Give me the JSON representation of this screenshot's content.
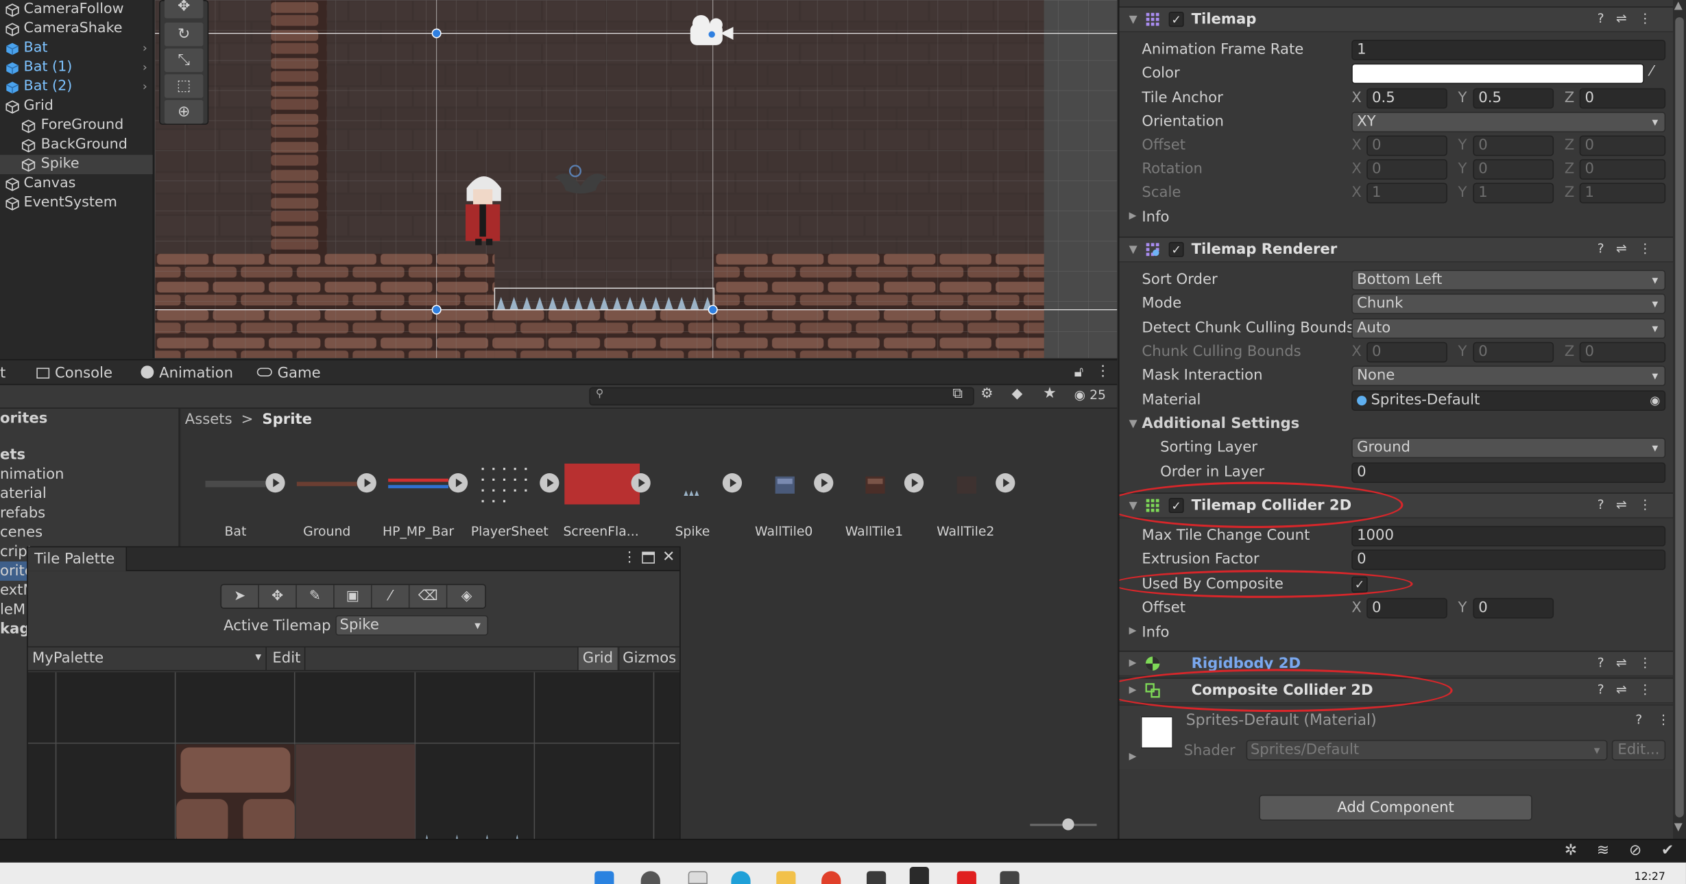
{
  "hierarchy": {
    "items": [
      {
        "label": "CameraFollow"
      },
      {
        "label": "CameraShake"
      },
      {
        "label": "Bat"
      },
      {
        "label": "Bat (1)"
      },
      {
        "label": "Bat (2)"
      },
      {
        "label": "Grid"
      },
      {
        "label": "ForeGround"
      },
      {
        "label": "BackGround"
      },
      {
        "label": "Spike"
      },
      {
        "label": "Canvas"
      },
      {
        "label": "EventSystem"
      }
    ]
  },
  "tabs": {
    "first_fragment": "t",
    "console": "Console",
    "animation": "Animation",
    "game": "Game"
  },
  "project": {
    "hidden_count": "25",
    "left_items": [
      "orites",
      "ets",
      "nimation",
      "aterial",
      "refabs",
      "cenes",
      "cript",
      "orite",
      "extM",
      "leM",
      "kag"
    ],
    "breadcrumb_root": "Assets",
    "breadcrumb_sep": ">",
    "breadcrumb_current": "Sprite",
    "assets": [
      {
        "label": "Bat"
      },
      {
        "label": "Ground"
      },
      {
        "label": "HP_MP_Bar"
      },
      {
        "label": "PlayerSheet"
      },
      {
        "label": "ScreenFla..."
      },
      {
        "label": "Spike"
      },
      {
        "label": "WallTile0"
      },
      {
        "label": "WallTile1"
      },
      {
        "label": "WallTile2"
      }
    ]
  },
  "tile_palette": {
    "title": "Tile Palette",
    "active_tilemap_label": "Active Tilemap",
    "active_tilemap_value": "Spike",
    "palette_name": "MyPalette",
    "edit": "Edit",
    "grid": "Grid",
    "gizmos": "Gizmos"
  },
  "inspector": {
    "tilemap": {
      "title": "Tilemap",
      "animation_frame_rate_label": "Animation Frame Rate",
      "animation_frame_rate": "1",
      "color_label": "Color",
      "tile_anchor_label": "Tile Anchor",
      "tile_anchor": {
        "x": "0.5",
        "y": "0.5",
        "z": "0"
      },
      "orientation_label": "Orientation",
      "orientation": "XY",
      "offset_label": "Offset",
      "offset": {
        "x": "0",
        "y": "0",
        "z": "0"
      },
      "rotation_label": "Rotation",
      "rotation": {
        "x": "0",
        "y": "0",
        "z": "0"
      },
      "scale_label": "Scale",
      "scale": {
        "x": "1",
        "y": "1",
        "z": "1"
      },
      "info_label": "Info"
    },
    "tilemap_renderer": {
      "title": "Tilemap Renderer",
      "sort_order_label": "Sort Order",
      "sort_order": "Bottom Left",
      "mode_label": "Mode",
      "mode": "Chunk",
      "detect_label": "Detect Chunk Culling Bounds",
      "detect": "Auto",
      "chunk_bounds_label": "Chunk Culling Bounds",
      "chunk_bounds": {
        "x": "0",
        "y": "0",
        "z": "0"
      },
      "mask_label": "Mask Interaction",
      "mask": "None",
      "material_label": "Material",
      "material": "Sprites-Default",
      "additional_label": "Additional Settings",
      "sorting_layer_label": "Sorting Layer",
      "sorting_layer": "Ground",
      "order_label": "Order in Layer",
      "order": "0"
    },
    "tilemap_collider": {
      "title": "Tilemap Collider 2D",
      "max_tile_label": "Max Tile Change Count",
      "max_tile": "1000",
      "extrusion_label": "Extrusion Factor",
      "extrusion": "0",
      "used_by_composite_label": "Used By Composite",
      "offset_label": "Offset",
      "offset": {
        "x": "0",
        "y": "0"
      },
      "info_label": "Info"
    },
    "rigidbody": {
      "title": "Rigidbody 2D"
    },
    "composite": {
      "title": "Composite Collider 2D"
    },
    "material_preview": {
      "name": "Sprites-Default (Material)",
      "shader_label": "Shader",
      "shader": "Sprites/Default",
      "edit": "Edit..."
    },
    "add_component": "Add Component"
  },
  "axis_labels": {
    "x": "X",
    "y": "Y",
    "z": "Z"
  },
  "clock": "12:27"
}
